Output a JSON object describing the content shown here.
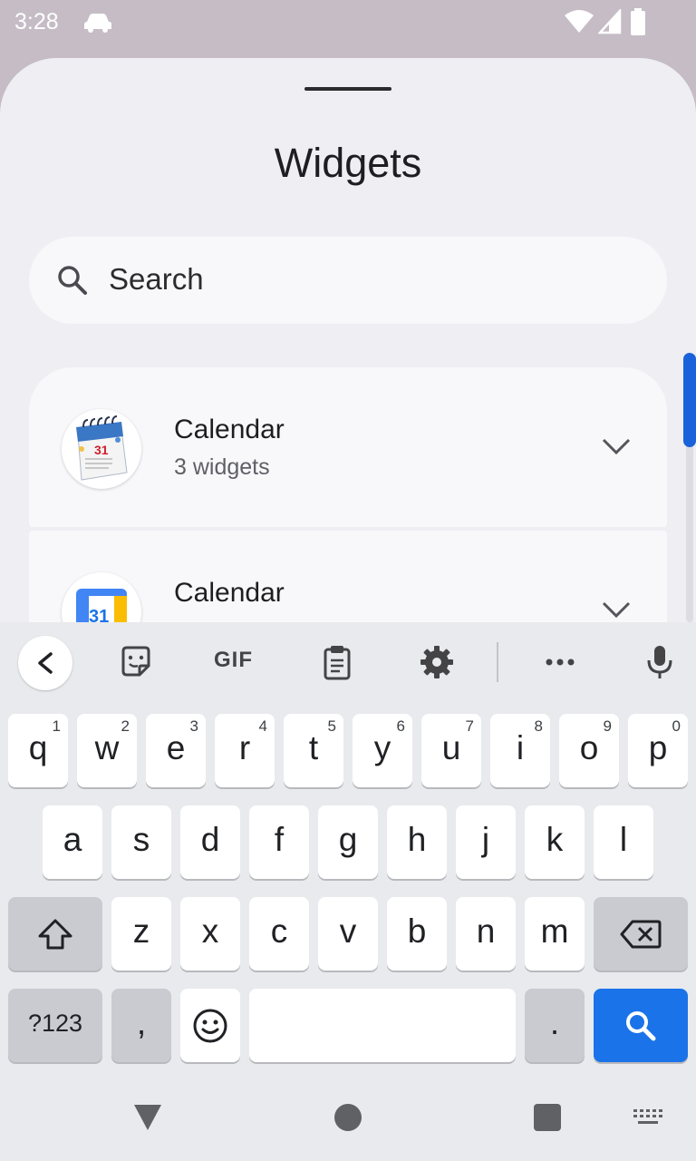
{
  "status_bar": {
    "time": "3:28",
    "icons": [
      "car-icon",
      "wifi-icon",
      "cell-signal-icon",
      "battery-icon"
    ]
  },
  "sheet": {
    "title": "Widgets",
    "search": {
      "placeholder": "Search"
    },
    "apps": [
      {
        "name": "Calendar",
        "subtitle": "3 widgets",
        "icon": "desk-calendar-icon",
        "icon_number": "31"
      },
      {
        "name": "Calendar",
        "subtitle": "",
        "icon": "google-calendar-icon",
        "icon_number": "31"
      }
    ]
  },
  "keyboard": {
    "toolbar": {
      "gif_label": "GIF",
      "icons": [
        "back-chevron-icon",
        "sticker-icon",
        "gif-icon",
        "clipboard-icon",
        "settings-icon",
        "more-icon",
        "microphone-icon"
      ]
    },
    "rows": {
      "row1": [
        {
          "label": "q",
          "hint": "1"
        },
        {
          "label": "w",
          "hint": "2"
        },
        {
          "label": "e",
          "hint": "3"
        },
        {
          "label": "r",
          "hint": "4"
        },
        {
          "label": "t",
          "hint": "5"
        },
        {
          "label": "y",
          "hint": "6"
        },
        {
          "label": "u",
          "hint": "7"
        },
        {
          "label": "i",
          "hint": "8"
        },
        {
          "label": "o",
          "hint": "9"
        },
        {
          "label": "p",
          "hint": "0"
        }
      ],
      "row2": [
        "a",
        "s",
        "d",
        "f",
        "g",
        "h",
        "j",
        "k",
        "l"
      ],
      "row3": [
        "z",
        "x",
        "c",
        "v",
        "b",
        "n",
        "m"
      ],
      "row4": {
        "symbols": "?123",
        "comma": ",",
        "period": "."
      }
    },
    "colors": {
      "action_key": "#1a73e8",
      "key": "#ffffff",
      "function_key": "#c9cbd0"
    }
  },
  "nav_bar": {
    "icons": [
      "nav-back-icon",
      "nav-home-icon",
      "nav-recents-icon",
      "keyboard-switch-icon"
    ]
  },
  "colors": {
    "accent": "#1a62d9",
    "sheet_bg": "#eeeef3"
  }
}
